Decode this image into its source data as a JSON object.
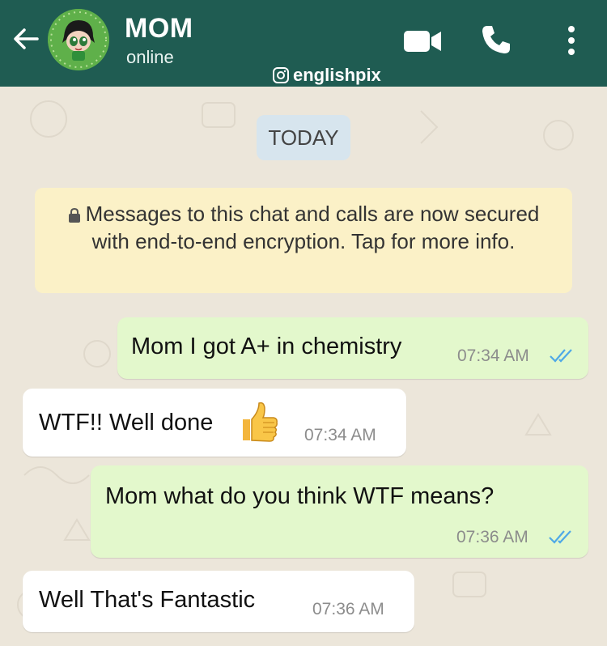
{
  "header": {
    "contact_name": "MOM",
    "status": "online",
    "watermark": "englishpix",
    "icons": [
      "back-arrow-icon",
      "avatar",
      "video-call-icon",
      "phone-icon",
      "more-vert-icon"
    ],
    "colors": {
      "header_bg": "#1f5c52",
      "outgoing_bg": "#e3f8cc",
      "incoming_bg": "#ffffff",
      "tick_blue": "#4fa9e6"
    }
  },
  "chat": {
    "date_chip": "TODAY",
    "encryption_notice": "Messages to this chat and calls are now secured with end-to-end encryption. Tap for more info.",
    "messages": [
      {
        "direction": "outgoing",
        "text": "Mom I got A+ in chemistry",
        "time": "07:34 AM",
        "status": "read"
      },
      {
        "direction": "incoming",
        "text": "WTF!! Well done",
        "emoji": "thumbs-up",
        "time": "07:34 AM"
      },
      {
        "direction": "outgoing",
        "text": "Mom what do you think WTF means?",
        "time": "07:36 AM",
        "status": "read"
      },
      {
        "direction": "incoming",
        "text": "Well That's Fantastic",
        "time": "07:36 AM"
      }
    ]
  }
}
